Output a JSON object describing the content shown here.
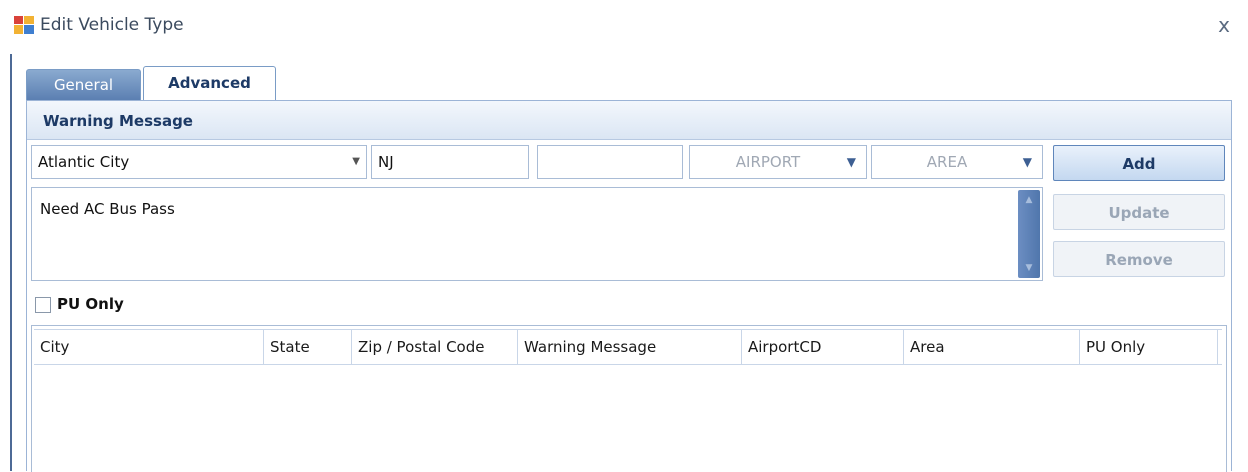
{
  "window": {
    "title": "Edit Vehicle Type",
    "close_glyph": "x"
  },
  "tabs": [
    {
      "label": "General"
    },
    {
      "label": "Advanced"
    }
  ],
  "group": {
    "title": "Warning Message"
  },
  "form": {
    "city": "Atlantic City",
    "state": "NJ",
    "zip": "",
    "airport_placeholder": "AIRPORT",
    "area_placeholder": "AREA",
    "message": "Need AC Bus Pass",
    "pu_only_label": "PU Only",
    "pu_only_checked": false
  },
  "buttons": {
    "add": "Add",
    "update": "Update",
    "remove": "Remove"
  },
  "grid": {
    "columns": [
      "City",
      "State",
      "Zip / Postal Code",
      "Warning Message",
      "AirportCD",
      "Area",
      "PU Only"
    ],
    "rows": []
  },
  "icons": {
    "app": "window-app-icon",
    "close": "close-icon",
    "dropdown": "chevron-down-icon"
  },
  "colors": {
    "accent": "#1d3a66",
    "tab_inactive": "#5b7fb2",
    "border": "#a9bcd6"
  }
}
